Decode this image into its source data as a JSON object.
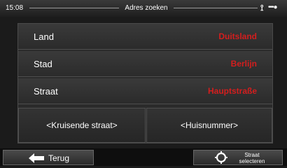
{
  "status": {
    "time": "15:08",
    "title": "Adres zoeken",
    "icons": [
      "satellite-icon",
      "signal-dots-icon"
    ]
  },
  "address": {
    "rows": [
      {
        "label": "Land",
        "value": "Duitsland"
      },
      {
        "label": "Stad",
        "value": "Berlijn"
      },
      {
        "label": "Straat",
        "value": "Hauptstraße"
      }
    ],
    "cross_street": "<Kruisende straat>",
    "house_number": "<Huisnummer>"
  },
  "bottom": {
    "back_label": "Terug",
    "select_label": "Straat selecteren",
    "icons": [
      "arrow-left-icon",
      "crosshair-icon"
    ]
  },
  "colors": {
    "value_red": "#d41e1e",
    "background": "#1b1b1b"
  }
}
